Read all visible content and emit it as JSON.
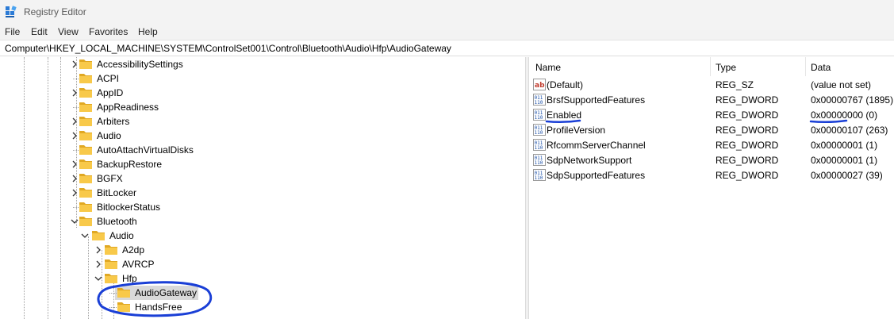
{
  "window": {
    "title": "Registry Editor"
  },
  "menu": [
    "File",
    "Edit",
    "View",
    "Favorites",
    "Help"
  ],
  "address": "Computer\\HKEY_LOCAL_MACHINE\\SYSTEM\\ControlSet001\\Control\\Bluetooth\\Audio\\Hfp\\AudioGateway",
  "tree": [
    {
      "label": "AccessibilitySettings",
      "expander": "collapsed",
      "depth": 0
    },
    {
      "label": "ACPI",
      "expander": "none",
      "depth": 0
    },
    {
      "label": "AppID",
      "expander": "collapsed",
      "depth": 0
    },
    {
      "label": "AppReadiness",
      "expander": "none",
      "depth": 0
    },
    {
      "label": "Arbiters",
      "expander": "collapsed",
      "depth": 0
    },
    {
      "label": "Audio",
      "expander": "collapsed",
      "depth": 0
    },
    {
      "label": "AutoAttachVirtualDisks",
      "expander": "none",
      "depth": 0
    },
    {
      "label": "BackupRestore",
      "expander": "collapsed",
      "depth": 0
    },
    {
      "label": "BGFX",
      "expander": "collapsed",
      "depth": 0
    },
    {
      "label": "BitLocker",
      "expander": "collapsed",
      "depth": 0
    },
    {
      "label": "BitlockerStatus",
      "expander": "none",
      "depth": 0
    },
    {
      "label": "Bluetooth",
      "expander": "expanded",
      "depth": 0
    },
    {
      "label": "Audio",
      "expander": "expanded",
      "depth": 1
    },
    {
      "label": "A2dp",
      "expander": "collapsed",
      "depth": 2
    },
    {
      "label": "AVRCP",
      "expander": "collapsed",
      "depth": 2
    },
    {
      "label": "Hfp",
      "expander": "expanded",
      "depth": 2
    },
    {
      "label": "AudioGateway",
      "expander": "none",
      "depth": 3,
      "selected": true
    },
    {
      "label": "HandsFree",
      "expander": "none",
      "depth": 3
    }
  ],
  "columns": {
    "name": "Name",
    "type": "Type",
    "data": "Data"
  },
  "values": [
    {
      "icon": "string-value-icon",
      "name": "(Default)",
      "type": "REG_SZ",
      "data": "(value not set)"
    },
    {
      "icon": "binary-value-icon",
      "name": "BrsfSupportedFeatures",
      "type": "REG_DWORD",
      "data": "0x00000767 (1895)"
    },
    {
      "icon": "binary-value-icon",
      "name": "Enabled",
      "type": "REG_DWORD",
      "data": "0x00000000 (0)"
    },
    {
      "icon": "binary-value-icon",
      "name": "ProfileVersion",
      "type": "REG_DWORD",
      "data": "0x00000107 (263)"
    },
    {
      "icon": "binary-value-icon",
      "name": "RfcommServerChannel",
      "type": "REG_DWORD",
      "data": "0x00000001 (1)"
    },
    {
      "icon": "binary-value-icon",
      "name": "SdpNetworkSupport",
      "type": "REG_DWORD",
      "data": "0x00000001 (1)"
    },
    {
      "icon": "binary-value-icon",
      "name": "SdpSupportedFeatures",
      "type": "REG_DWORD",
      "data": "0x00000027 (39)"
    }
  ],
  "colors": {
    "annotation": "#1a3fd6",
    "folder": "#f8c94a",
    "folderDark": "#e0a823",
    "selection": "#d9d9d9"
  }
}
